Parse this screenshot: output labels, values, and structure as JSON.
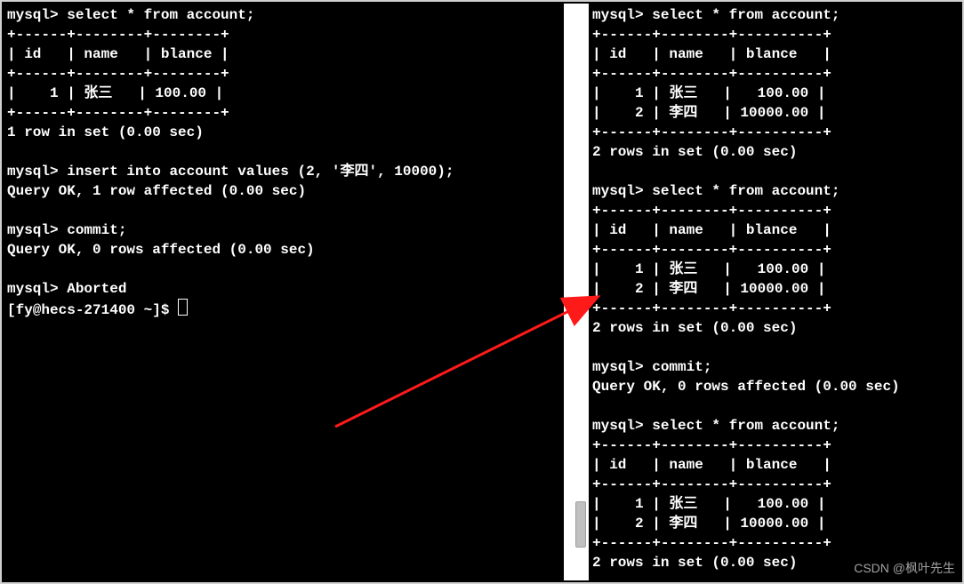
{
  "prompt_mysql": "mysql> ",
  "prompt_shell": "[fy@hecs-271400 ~]$ ",
  "left": {
    "q1": "select * from account;",
    "border": "+------+--------+--------+",
    "header": "| id   | name   | blance |",
    "row1": "|    1 | 张三   | 100.00 |",
    "footer1": "1 row in set (0.00 sec)",
    "q2": "insert into account values (2, '李四', 10000);",
    "resp2": "Query OK, 1 row affected (0.00 sec)",
    "q3": "commit;",
    "resp3": "Query OK, 0 rows affected (0.00 sec)",
    "aborted": "Aborted"
  },
  "right": {
    "q1": "select * from account;",
    "border": "+------+--------+----------+",
    "header": "| id   | name   | blance   |",
    "row1": "|    1 | 张三   |   100.00 |",
    "row2": "|    2 | 李四   | 10000.00 |",
    "footer": "2 rows in set (0.00 sec)",
    "q2": "select * from account;",
    "commit": "commit;",
    "commit_resp": "Query OK, 0 rows affected (0.00 sec)",
    "q3": "select * from account;"
  },
  "watermark": "CSDN @枫叶先生"
}
